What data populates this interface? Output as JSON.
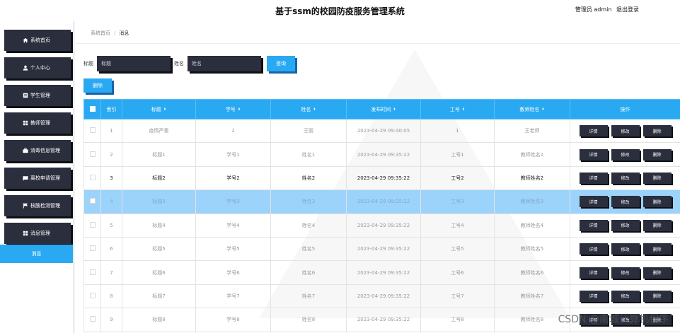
{
  "app": {
    "title": "基于ssm的校园防疫服务管理系统",
    "user_label": "管理员 admin",
    "logout_label": "退出登录"
  },
  "sidebar": {
    "items": [
      {
        "label": "系统首页",
        "icon": "home-icon"
      },
      {
        "label": "个人中心",
        "icon": "user-icon"
      },
      {
        "label": "学生管理",
        "icon": "document-icon"
      },
      {
        "label": "教师管理",
        "icon": "grid-icon"
      },
      {
        "label": "消毒信息管理",
        "icon": "briefcase-icon"
      },
      {
        "label": "离校申请管理",
        "icon": "message-icon"
      },
      {
        "label": "核酸检测管理",
        "icon": "flag-icon"
      },
      {
        "label": "消息管理",
        "icon": "grid-icon"
      }
    ],
    "active_sub": "消息"
  },
  "breadcrumb": {
    "home": "系统首页",
    "separator": "/",
    "current": "消息"
  },
  "search": {
    "title_label": "标题",
    "title_placeholder": "标题",
    "name_label": "姓名",
    "name_placeholder": "姓名",
    "query_label": "查询",
    "delete_label": "删除"
  },
  "table": {
    "headers": [
      "索引",
      "标题",
      "学号",
      "姓名",
      "发布时间",
      "工号",
      "教师姓名",
      "操作"
    ],
    "action_labels": {
      "detail": "详情",
      "edit": "修改",
      "delete": "删除"
    },
    "rows": [
      {
        "index": "1",
        "title": "疫情严重",
        "student_no": "2",
        "name": "王丽",
        "time": "2023-04-29 09:40:05",
        "work_no": "1",
        "teacher": "王老师"
      },
      {
        "index": "2",
        "title": "标题1",
        "student_no": "学号1",
        "name": "姓名1",
        "time": "2023-04-29 09:35:22",
        "work_no": "工号1",
        "teacher": "教师姓名1"
      },
      {
        "index": "3",
        "title": "标题2",
        "student_no": "学号2",
        "name": "姓名2",
        "time": "2023-04-29 09:35:22",
        "work_no": "工号2",
        "teacher": "教师姓名2"
      },
      {
        "index": "4",
        "title": "标题3",
        "student_no": "学号3",
        "name": "姓名3",
        "time": "2023-04-29 09:35:22",
        "work_no": "工号3",
        "teacher": "教师姓名3"
      },
      {
        "index": "5",
        "title": "标题4",
        "student_no": "学号4",
        "name": "姓名4",
        "time": "2023-04-29 09:35:22",
        "work_no": "工号4",
        "teacher": "教师姓名4"
      },
      {
        "index": "6",
        "title": "标题5",
        "student_no": "学号5",
        "name": "姓名5",
        "time": "2023-04-29 09:35:22",
        "work_no": "工号5",
        "teacher": "教师姓名5"
      },
      {
        "index": "7",
        "title": "标题6",
        "student_no": "学号6",
        "name": "姓名6",
        "time": "2023-04-29 09:35:22",
        "work_no": "工号6",
        "teacher": "教师姓名6"
      },
      {
        "index": "8",
        "title": "标题7",
        "student_no": "学号7",
        "name": "姓名7",
        "time": "2023-04-29 09:35:22",
        "work_no": "工号7",
        "teacher": "教师姓名7"
      },
      {
        "index": "9",
        "title": "标题8",
        "student_no": "学号8",
        "name": "姓名8",
        "time": "2023-04-29 09:35:22",
        "work_no": "工号8",
        "teacher": "教师姓名8"
      }
    ],
    "selected_row_index": "4",
    "hovered_row_index": "3"
  },
  "watermark": "CSDN @南城计算机程序",
  "colors": {
    "accent": "#2aa9f3",
    "dark_button": "#2b2e3d",
    "selected_row": "#9cd3fa"
  }
}
